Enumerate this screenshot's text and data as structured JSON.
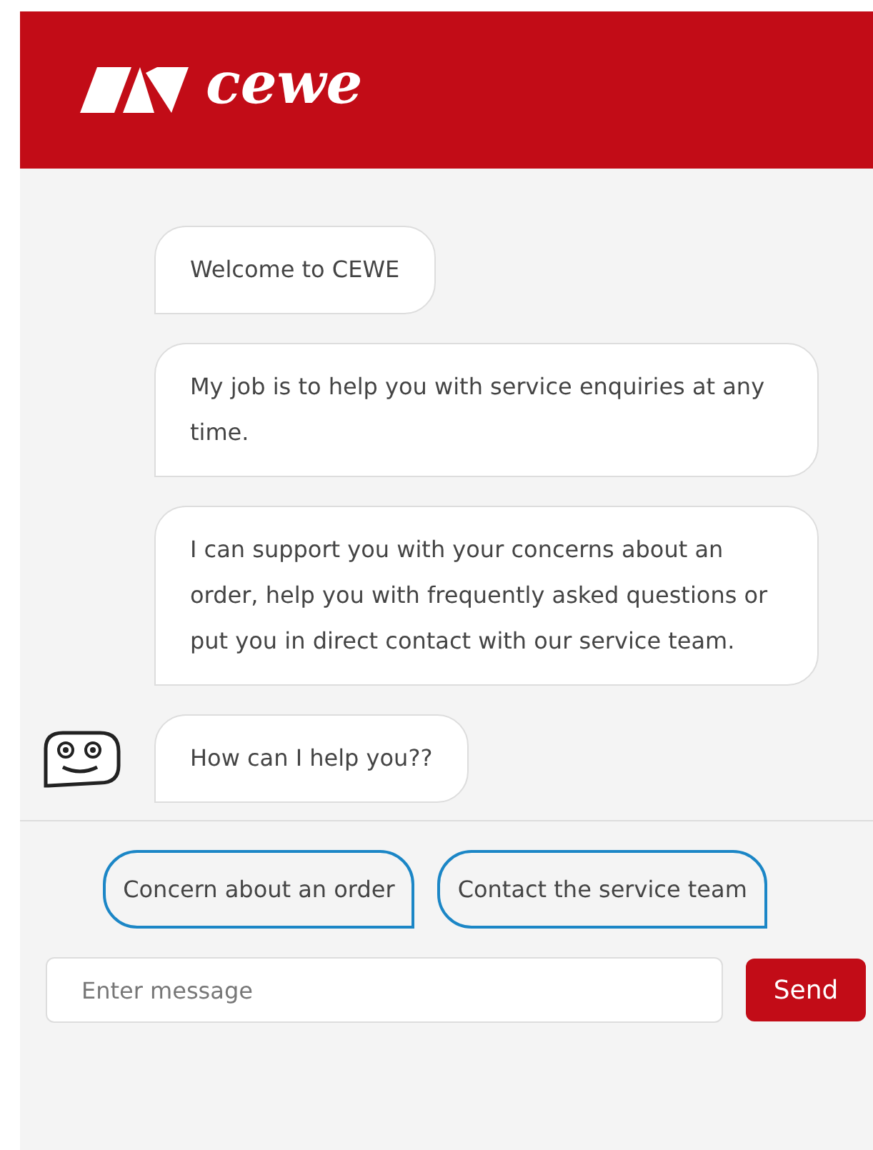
{
  "header": {
    "logo_text": "cewe"
  },
  "messages": [
    "Welcome to CEWE",
    "My job is to help you with service enquiries at any time.",
    "I can support you with your concerns about an order, help you with frequently asked questions or put you in direct contact with our service team.",
    "How can I help you??"
  ],
  "quick_replies": [
    "Concern about an order",
    "Contact the service team"
  ],
  "composer": {
    "placeholder": "Enter message",
    "send_label": "Send"
  }
}
